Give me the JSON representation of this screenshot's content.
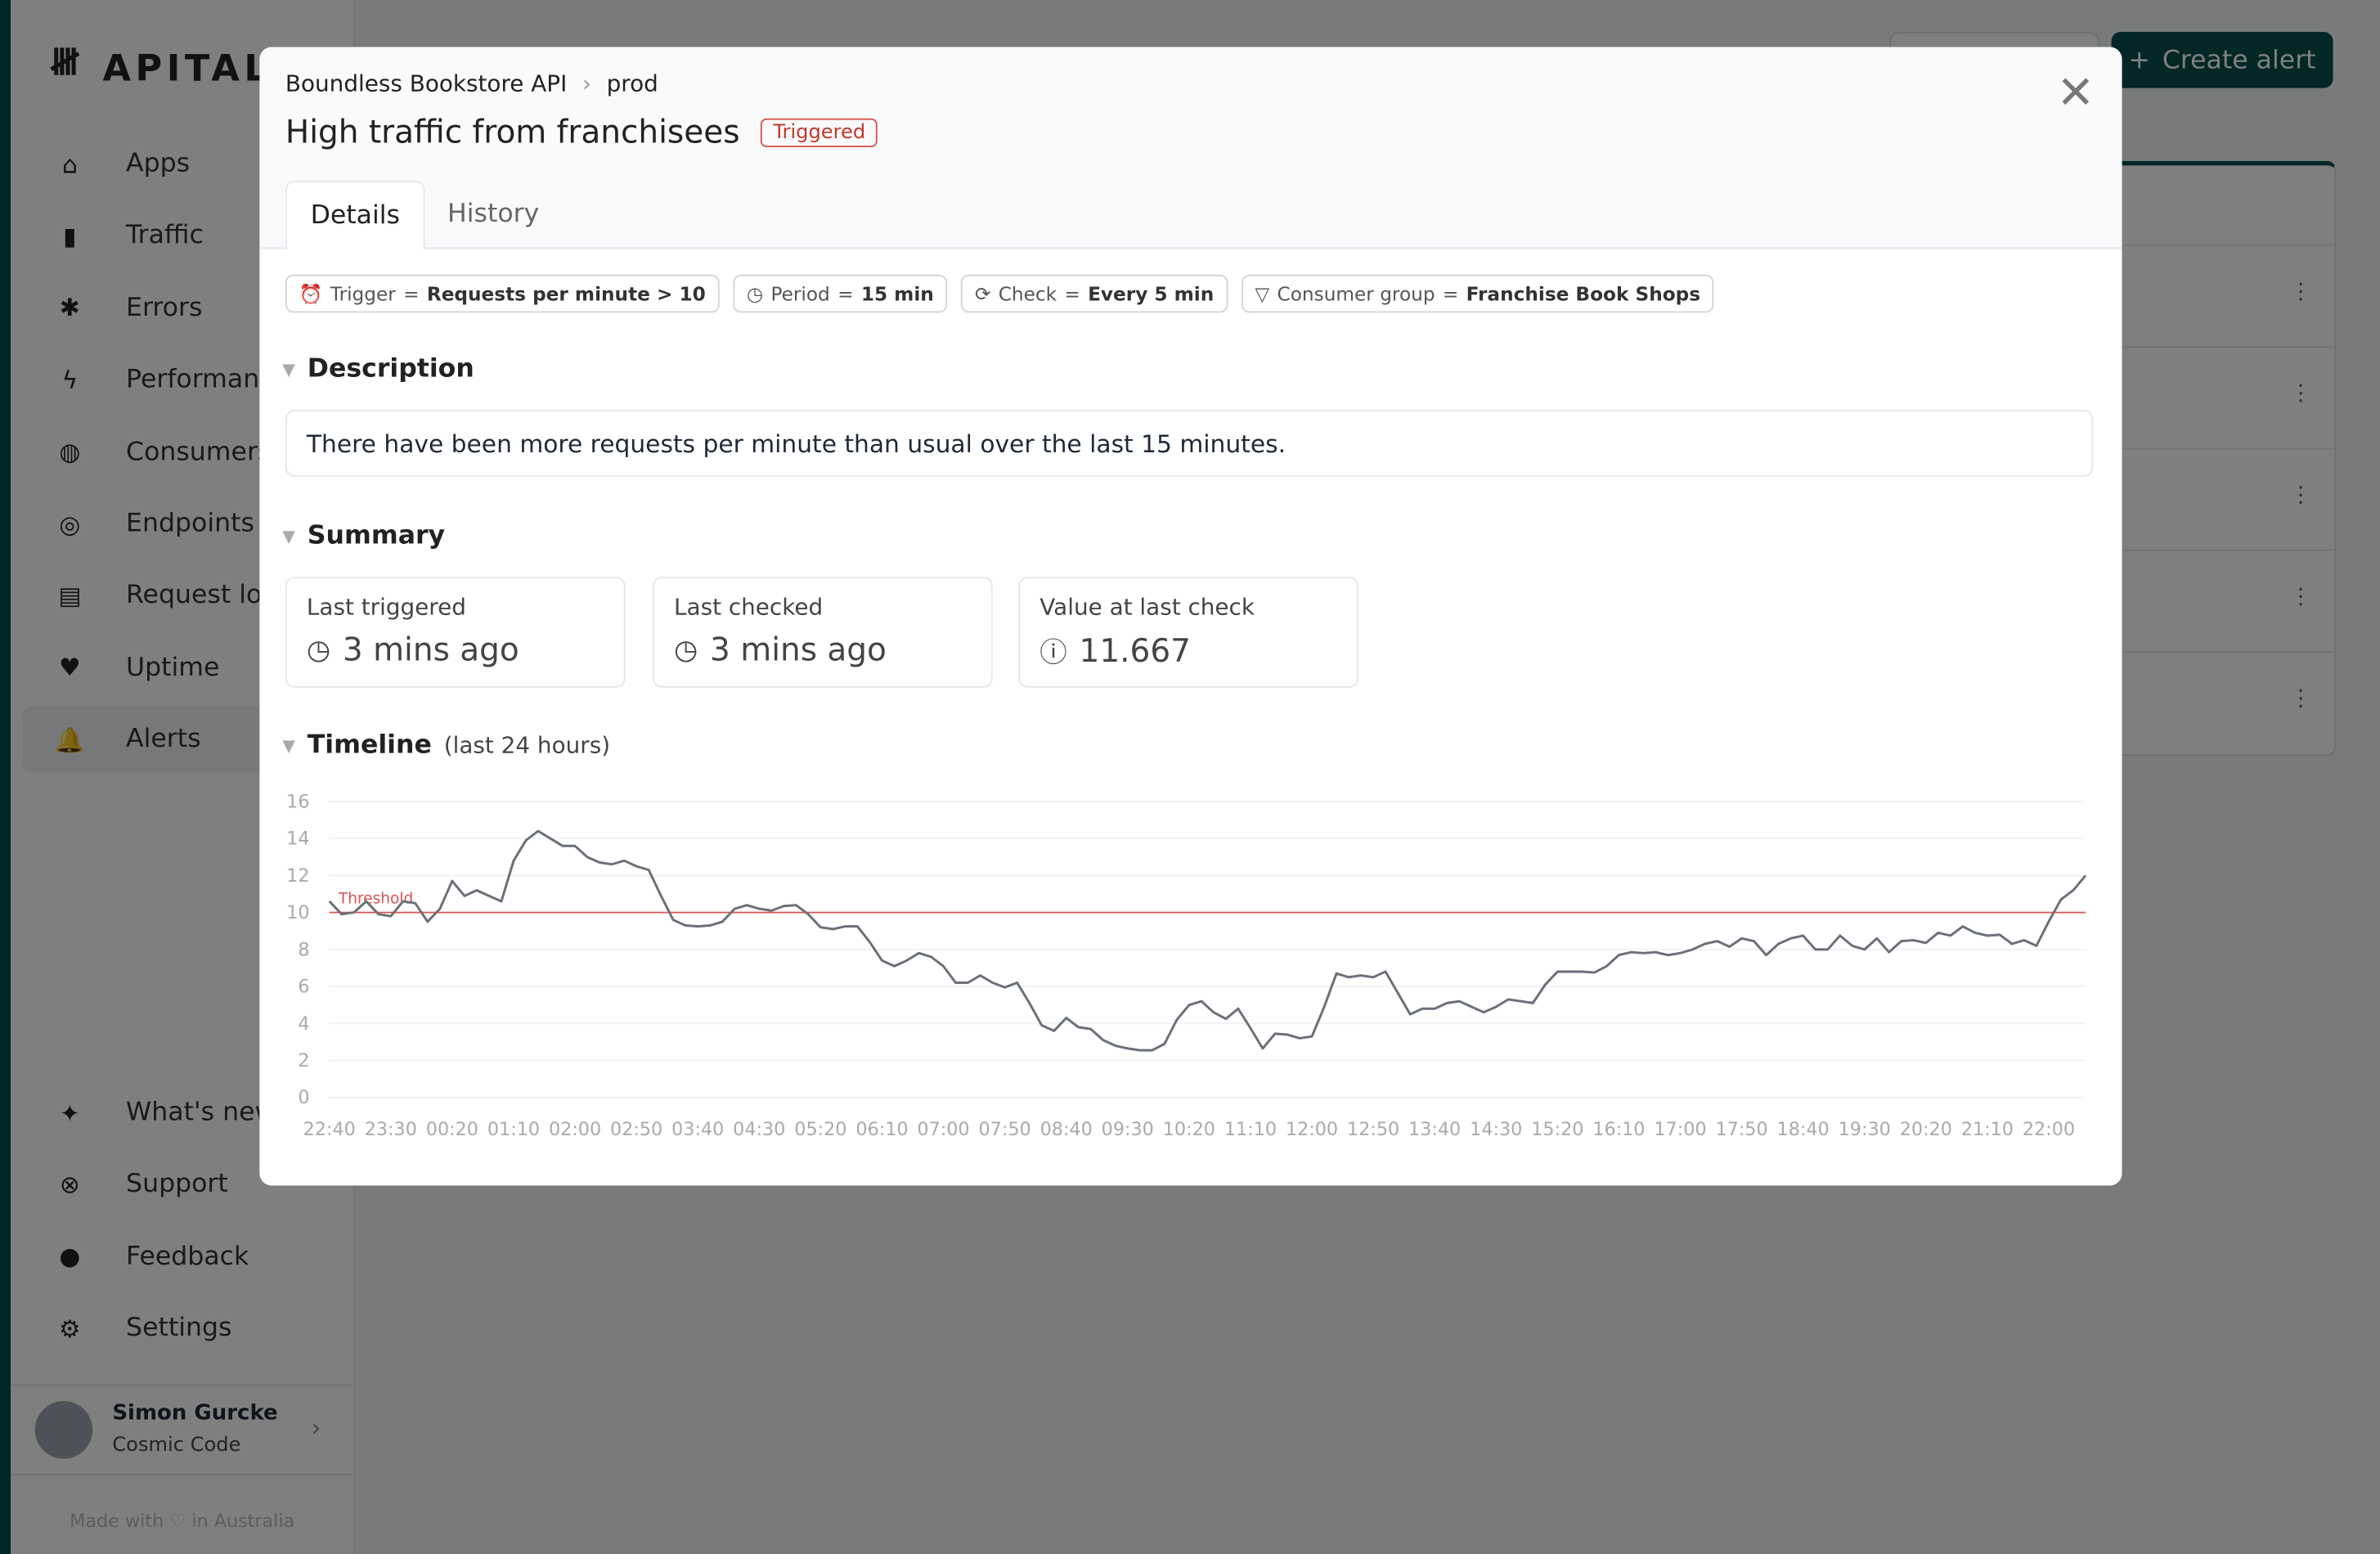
{
  "brand": {
    "name": "APITALLY",
    "accent": "#064c4c"
  },
  "sidebar": {
    "items": [
      {
        "label": "Apps",
        "icon": "house-icon"
      },
      {
        "label": "Traffic",
        "icon": "bar-chart-icon"
      },
      {
        "label": "Errors",
        "icon": "bug-icon"
      },
      {
        "label": "Performance",
        "icon": "bolt-icon"
      },
      {
        "label": "Consumers",
        "icon": "fingerprint-icon"
      },
      {
        "label": "Endpoints",
        "icon": "target-icon"
      },
      {
        "label": "Request log",
        "icon": "scroll-icon"
      },
      {
        "label": "Uptime",
        "icon": "heart-pulse-icon"
      },
      {
        "label": "Alerts",
        "icon": "bell-icon",
        "active": true
      }
    ],
    "bottom_items": [
      {
        "label": "What's new",
        "icon": "sparkles-icon"
      },
      {
        "label": "Support",
        "icon": "lifebuoy-icon"
      },
      {
        "label": "Feedback",
        "icon": "chat-icon"
      },
      {
        "label": "Settings",
        "icon": "gear-icon"
      }
    ],
    "user": {
      "name": "Simon Gurcke",
      "org": "Cosmic Code"
    },
    "footer": "Made with ♡ in Australia"
  },
  "toolbar": {
    "create_alert": "Create alert"
  },
  "modal": {
    "breadcrumb": [
      "Boundless Bookstore API",
      "prod"
    ],
    "title": "High traffic from franchisees",
    "status": "Triggered",
    "tabs": [
      "Details",
      "History"
    ],
    "pills": [
      {
        "key": "Trigger",
        "value": "Requests per minute > 10",
        "icon": "alarm-icon"
      },
      {
        "key": "Period",
        "value": "15 min",
        "icon": "clock-icon"
      },
      {
        "key": "Check",
        "value": "Every 5 min",
        "icon": "refresh-icon"
      },
      {
        "key": "Consumer group",
        "value": "Franchise Book Shops",
        "icon": "filter-icon"
      }
    ],
    "description_heading": "Description",
    "description": "There have been more requests per minute than usual over the last 15 minutes.",
    "summary_heading": "Summary",
    "summary": [
      {
        "label": "Last triggered",
        "value": "3 mins ago",
        "icon": "clock-icon"
      },
      {
        "label": "Last checked",
        "value": "3 mins ago",
        "icon": "clock-icon"
      },
      {
        "label": "Value at last check",
        "value": "11.667",
        "icon": "info-icon"
      }
    ],
    "timeline_heading": "Timeline",
    "timeline_sub": "(last 24 hours)"
  },
  "chart_data": {
    "type": "line",
    "threshold": 10,
    "threshold_label": "Threshold",
    "threshold_color": "#d9534f",
    "line_color": "#6b7078",
    "ylim": [
      0,
      16
    ],
    "yticks": [
      0,
      2,
      4,
      6,
      8,
      10,
      12,
      14,
      16
    ],
    "xticks": [
      "22:40",
      "23:30",
      "00:20",
      "01:10",
      "02:00",
      "02:50",
      "03:40",
      "04:30",
      "05:20",
      "06:10",
      "07:00",
      "07:50",
      "08:40",
      "09:30",
      "10:20",
      "11:10",
      "12:00",
      "12:50",
      "13:40",
      "14:30",
      "15:20",
      "16:10",
      "17:00",
      "17:50",
      "18:40",
      "19:30",
      "20:20",
      "21:10",
      "22:00"
    ],
    "grid": true,
    "values": [
      10.6,
      9.9,
      10.0,
      10.6,
      9.9,
      9.8,
      10.6,
      10.5,
      9.5,
      10.2,
      11.7,
      10.9,
      11.2,
      10.9,
      10.6,
      12.8,
      13.9,
      14.4,
      14.0,
      13.6,
      13.6,
      13.0,
      12.7,
      12.6,
      12.8,
      12.5,
      12.3,
      10.9,
      9.6,
      9.3,
      9.25,
      9.3,
      9.5,
      10.2,
      10.4,
      10.2,
      10.1,
      10.35,
      10.4,
      9.9,
      9.2,
      9.1,
      9.25,
      9.25,
      8.4,
      7.4,
      7.1,
      7.4,
      7.8,
      7.6,
      7.1,
      6.2,
      6.2,
      6.6,
      6.2,
      5.95,
      6.2,
      5.1,
      3.9,
      3.6,
      4.3,
      3.8,
      3.7,
      3.1,
      2.8,
      2.65,
      2.55,
      2.55,
      2.9,
      4.2,
      5.0,
      5.2,
      4.6,
      4.25,
      4.8,
      3.75,
      2.65,
      3.45,
      3.4,
      3.2,
      3.3,
      4.9,
      6.7,
      6.5,
      6.6,
      6.5,
      6.8,
      5.65,
      4.5,
      4.8,
      4.8,
      5.1,
      5.2,
      4.9,
      4.6,
      4.9,
      5.3,
      5.2,
      5.1,
      6.1,
      6.8,
      6.8,
      6.8,
      6.75,
      7.1,
      7.7,
      7.85,
      7.8,
      7.85,
      7.7,
      7.8,
      8.0,
      8.3,
      8.45,
      8.15,
      8.6,
      8.45,
      7.7,
      8.3,
      8.6,
      8.75,
      8.0,
      8.0,
      8.75,
      8.2,
      8.0,
      8.6,
      7.85,
      8.45,
      8.5,
      8.35,
      8.9,
      8.75,
      9.25,
      8.9,
      8.75,
      8.8,
      8.3,
      8.5,
      8.2,
      9.5,
      10.7,
      11.2,
      12.0
    ]
  }
}
